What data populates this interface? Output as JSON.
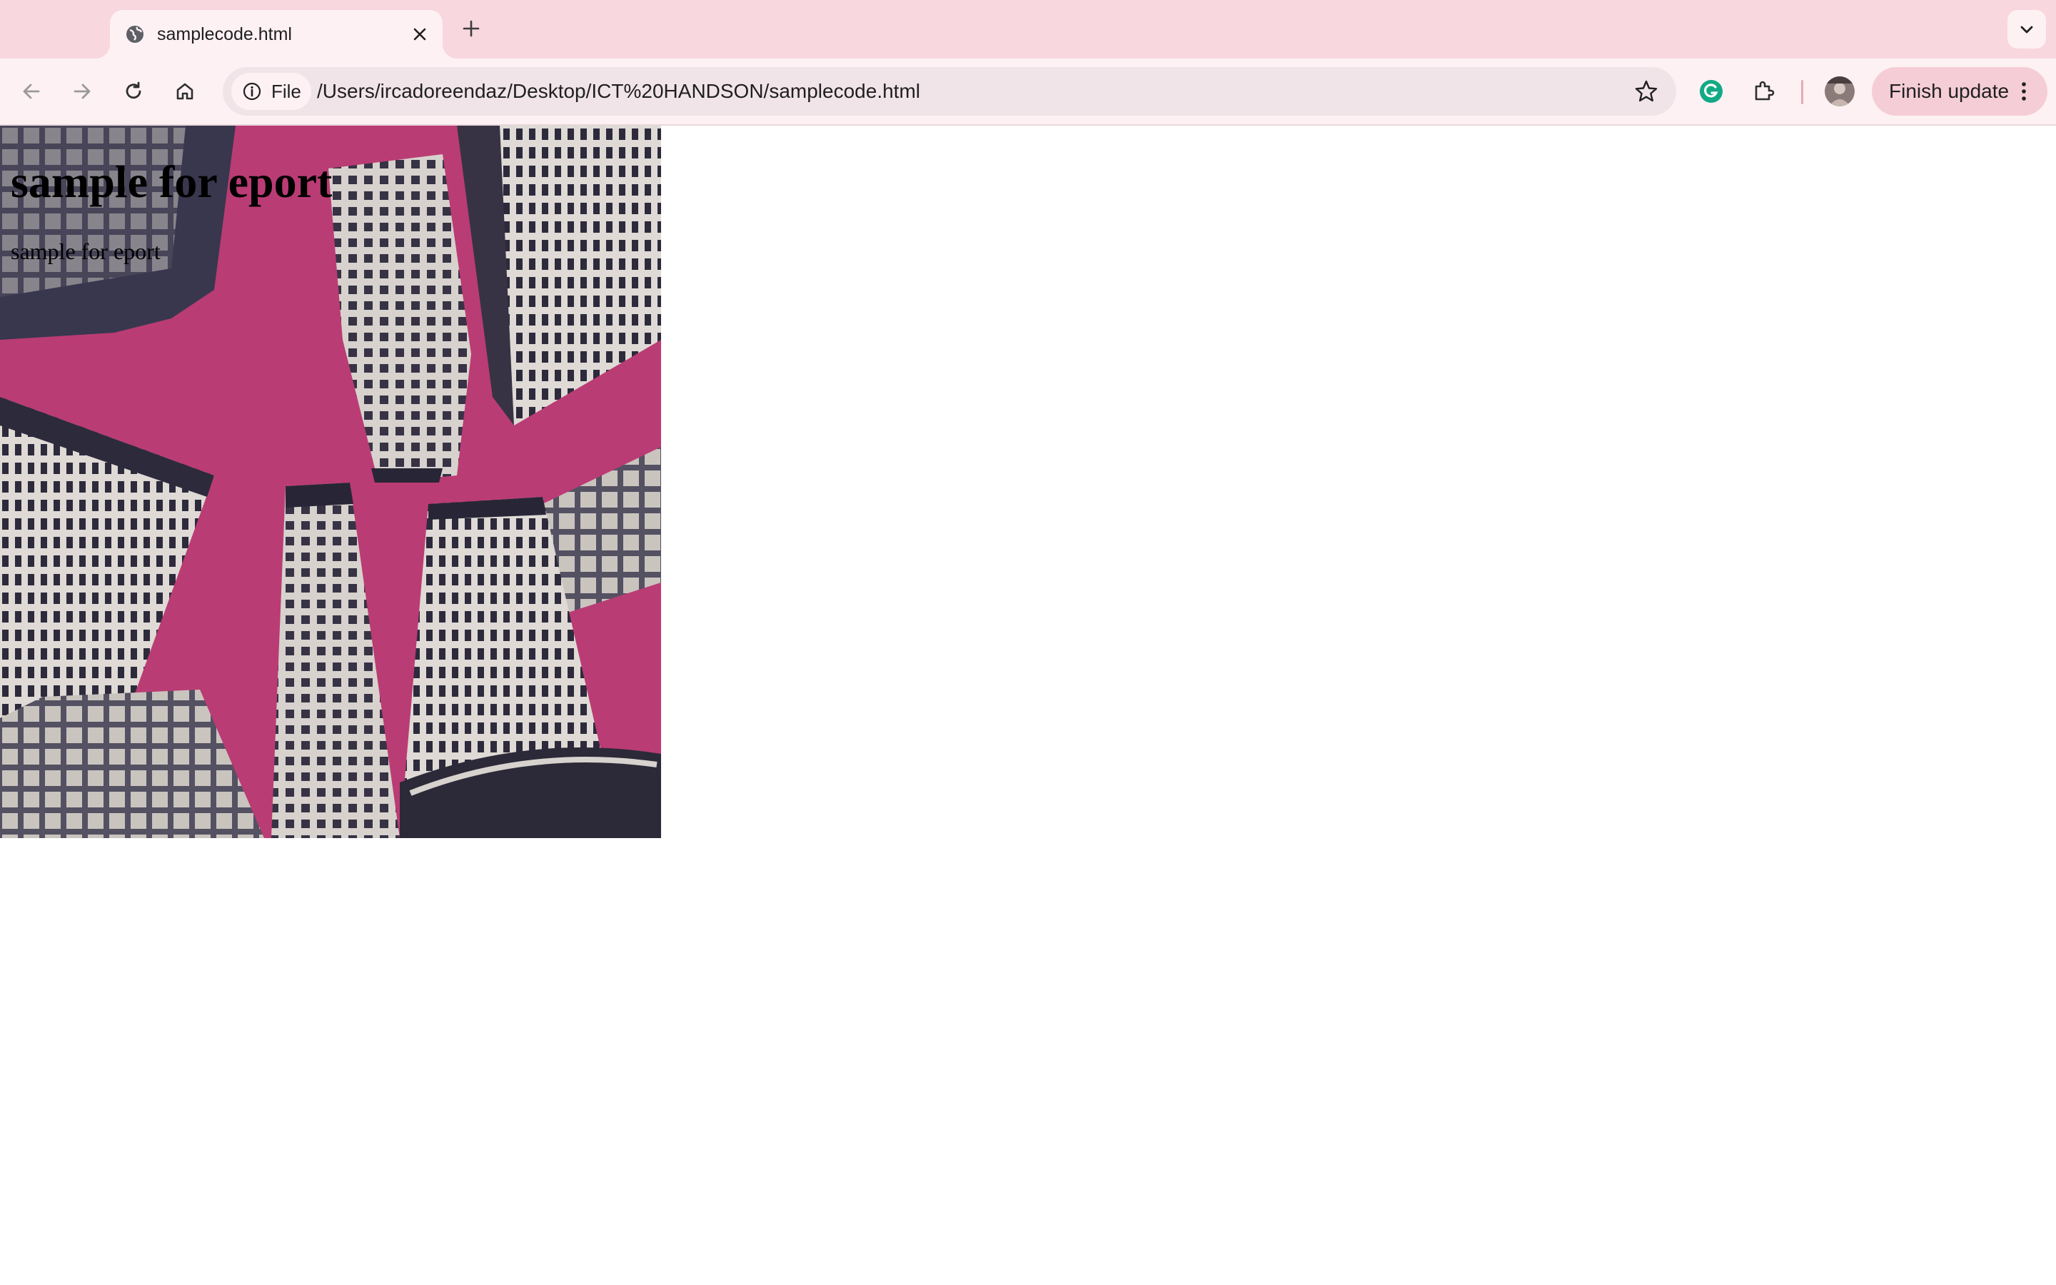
{
  "browser": {
    "tab": {
      "title": "samplecode.html",
      "favicon": "globe-icon"
    },
    "toolbar": {
      "back_icon": "arrow-left-icon",
      "forward_icon": "arrow-right-icon",
      "reload_icon": "reload-icon",
      "home_icon": "home-icon",
      "site_chip_label": "File",
      "url": "/Users/ircadoreendaz/Desktop/ICT%20HANDSON/samplecode.html",
      "bookmark_icon": "star-icon",
      "extensions": [
        "grammarly-icon",
        "puzzle-icon"
      ],
      "update_button_label": "Finish update"
    },
    "colors": {
      "tabstrip_bg": "#f8d7df",
      "toolbar_bg": "#fdf1f4",
      "omnibox_bg": "#f1e4e8",
      "update_button_bg": "#f5cdd7",
      "grammarly_green": "#15c39a"
    }
  },
  "page": {
    "heading": "sample for eport",
    "paragraph": "sample for eport",
    "background_image": {
      "subject": "looking up at skyscrapers against a magenta sky",
      "sky_color": "#c83f7b"
    }
  }
}
